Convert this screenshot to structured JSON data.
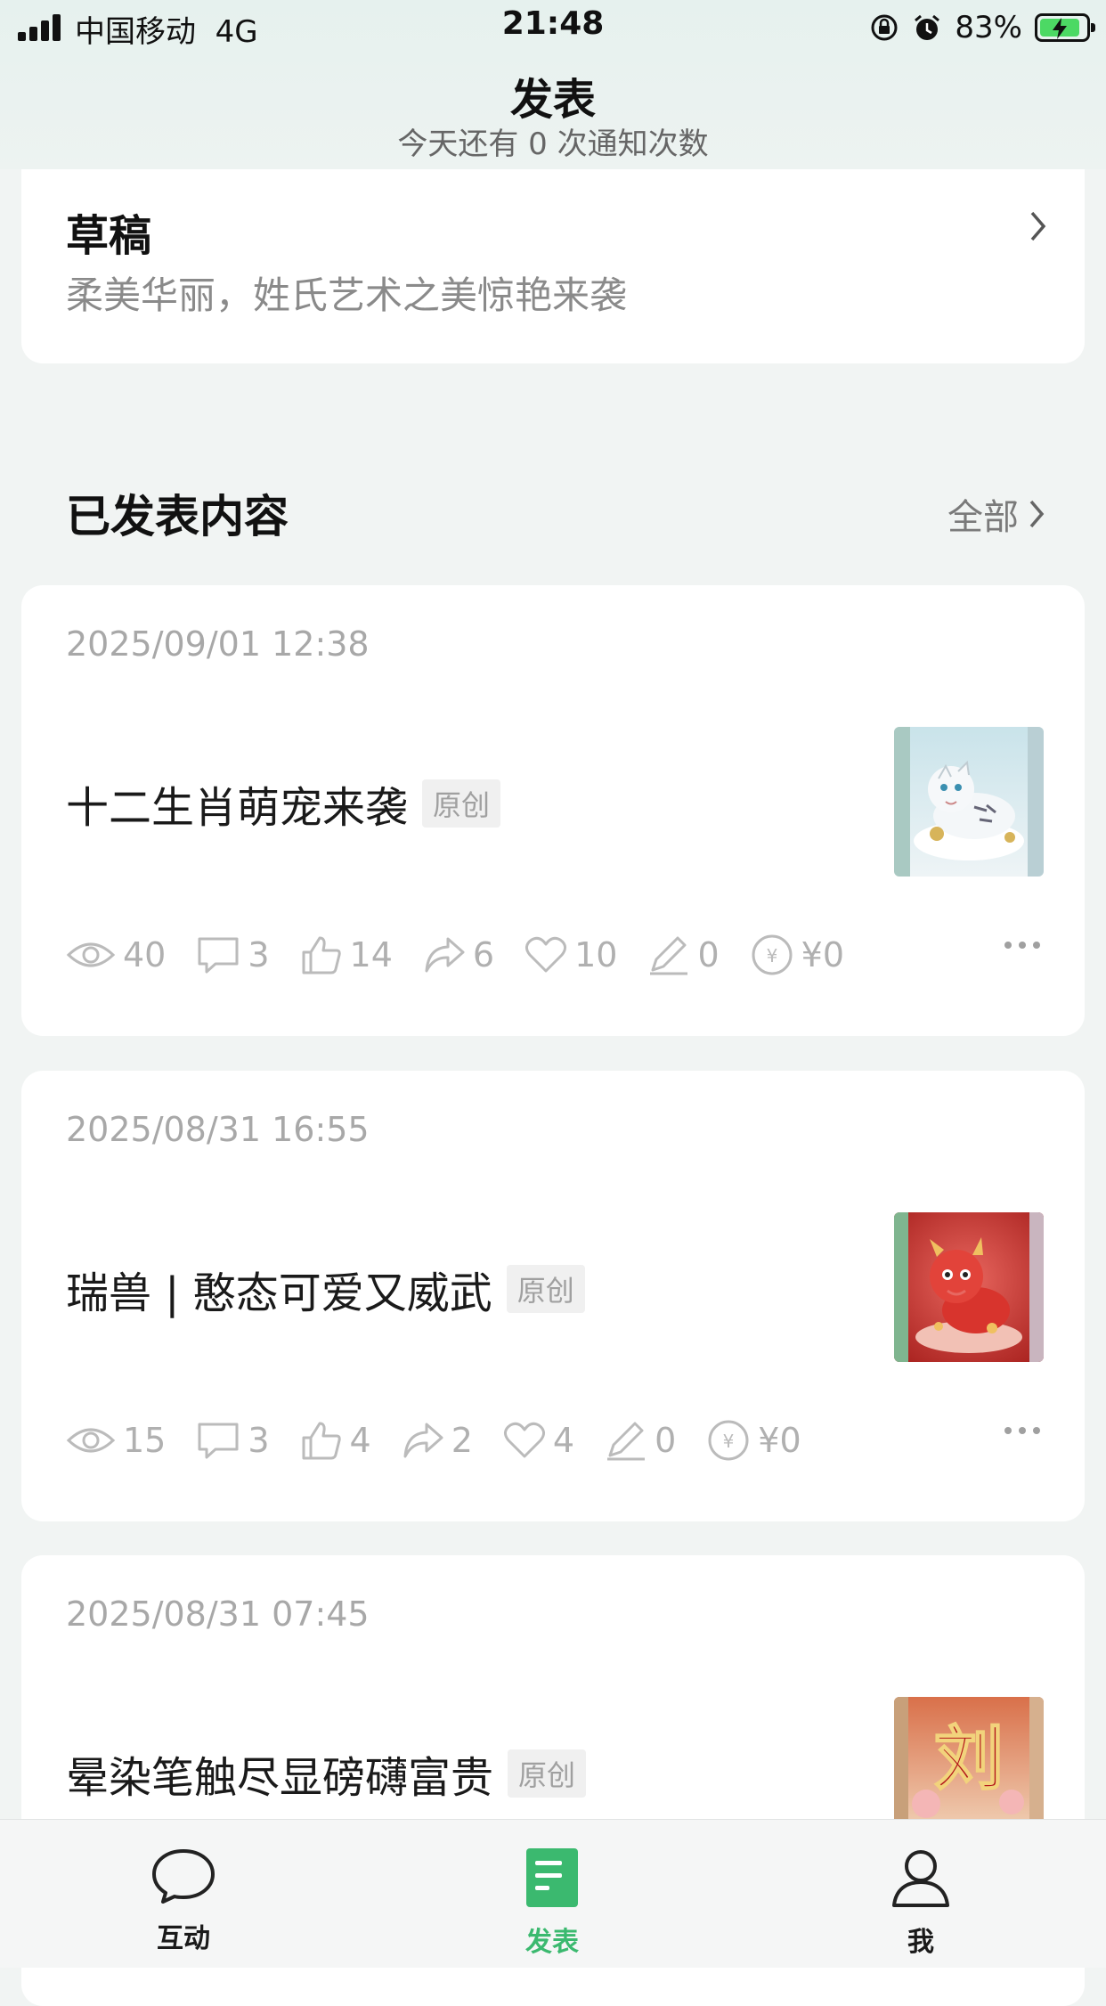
{
  "status_bar": {
    "carrier": "中国移动",
    "network": "4G",
    "time": "21:48",
    "battery_percent": "83%",
    "battery_level": 0.83,
    "icons": [
      "signal-icon",
      "orientation-lock-icon",
      "alarm-icon",
      "battery-icon"
    ]
  },
  "header": {
    "title": "发表",
    "subtitle": "今天还有 0 次通知次数"
  },
  "draft": {
    "title": "草稿",
    "description": "柔美华丽，姓氏艺术之美惊艳来袭"
  },
  "published": {
    "section_title": "已发表内容",
    "all_label": "全部"
  },
  "posts": [
    {
      "date": "2025/09/01 12:38",
      "title": "十二生肖萌宠来袭",
      "badge": "原创",
      "thumbnail": "white-tiger-image",
      "stats": {
        "views": "40",
        "comments": "3",
        "likes": "14",
        "shares": "6",
        "favorites": "10",
        "edits": "0",
        "reward": "¥0"
      }
    },
    {
      "date": "2025/08/31 16:55",
      "title": "瑞兽 | 憨态可爱又威武",
      "badge": "原创",
      "thumbnail": "red-dragon-image",
      "stats": {
        "views": "15",
        "comments": "3",
        "likes": "4",
        "shares": "2",
        "favorites": "4",
        "edits": "0",
        "reward": "¥0"
      }
    },
    {
      "date": "2025/08/31 07:45",
      "title": "晕染笔触尽显磅礴富贵",
      "badge": "原创",
      "thumbnail": "liu-character-image",
      "thumbnail_text": "刘"
    }
  ],
  "tabbar": {
    "items": [
      {
        "label": "互动",
        "icon": "chat-bubble-icon"
      },
      {
        "label": "发表",
        "icon": "document-icon",
        "active": true
      },
      {
        "label": "我",
        "icon": "person-icon"
      }
    ]
  },
  "colors": {
    "accent": "#3bb96f",
    "background": "#f1f4f3",
    "header_background": "#e6f1ee"
  }
}
